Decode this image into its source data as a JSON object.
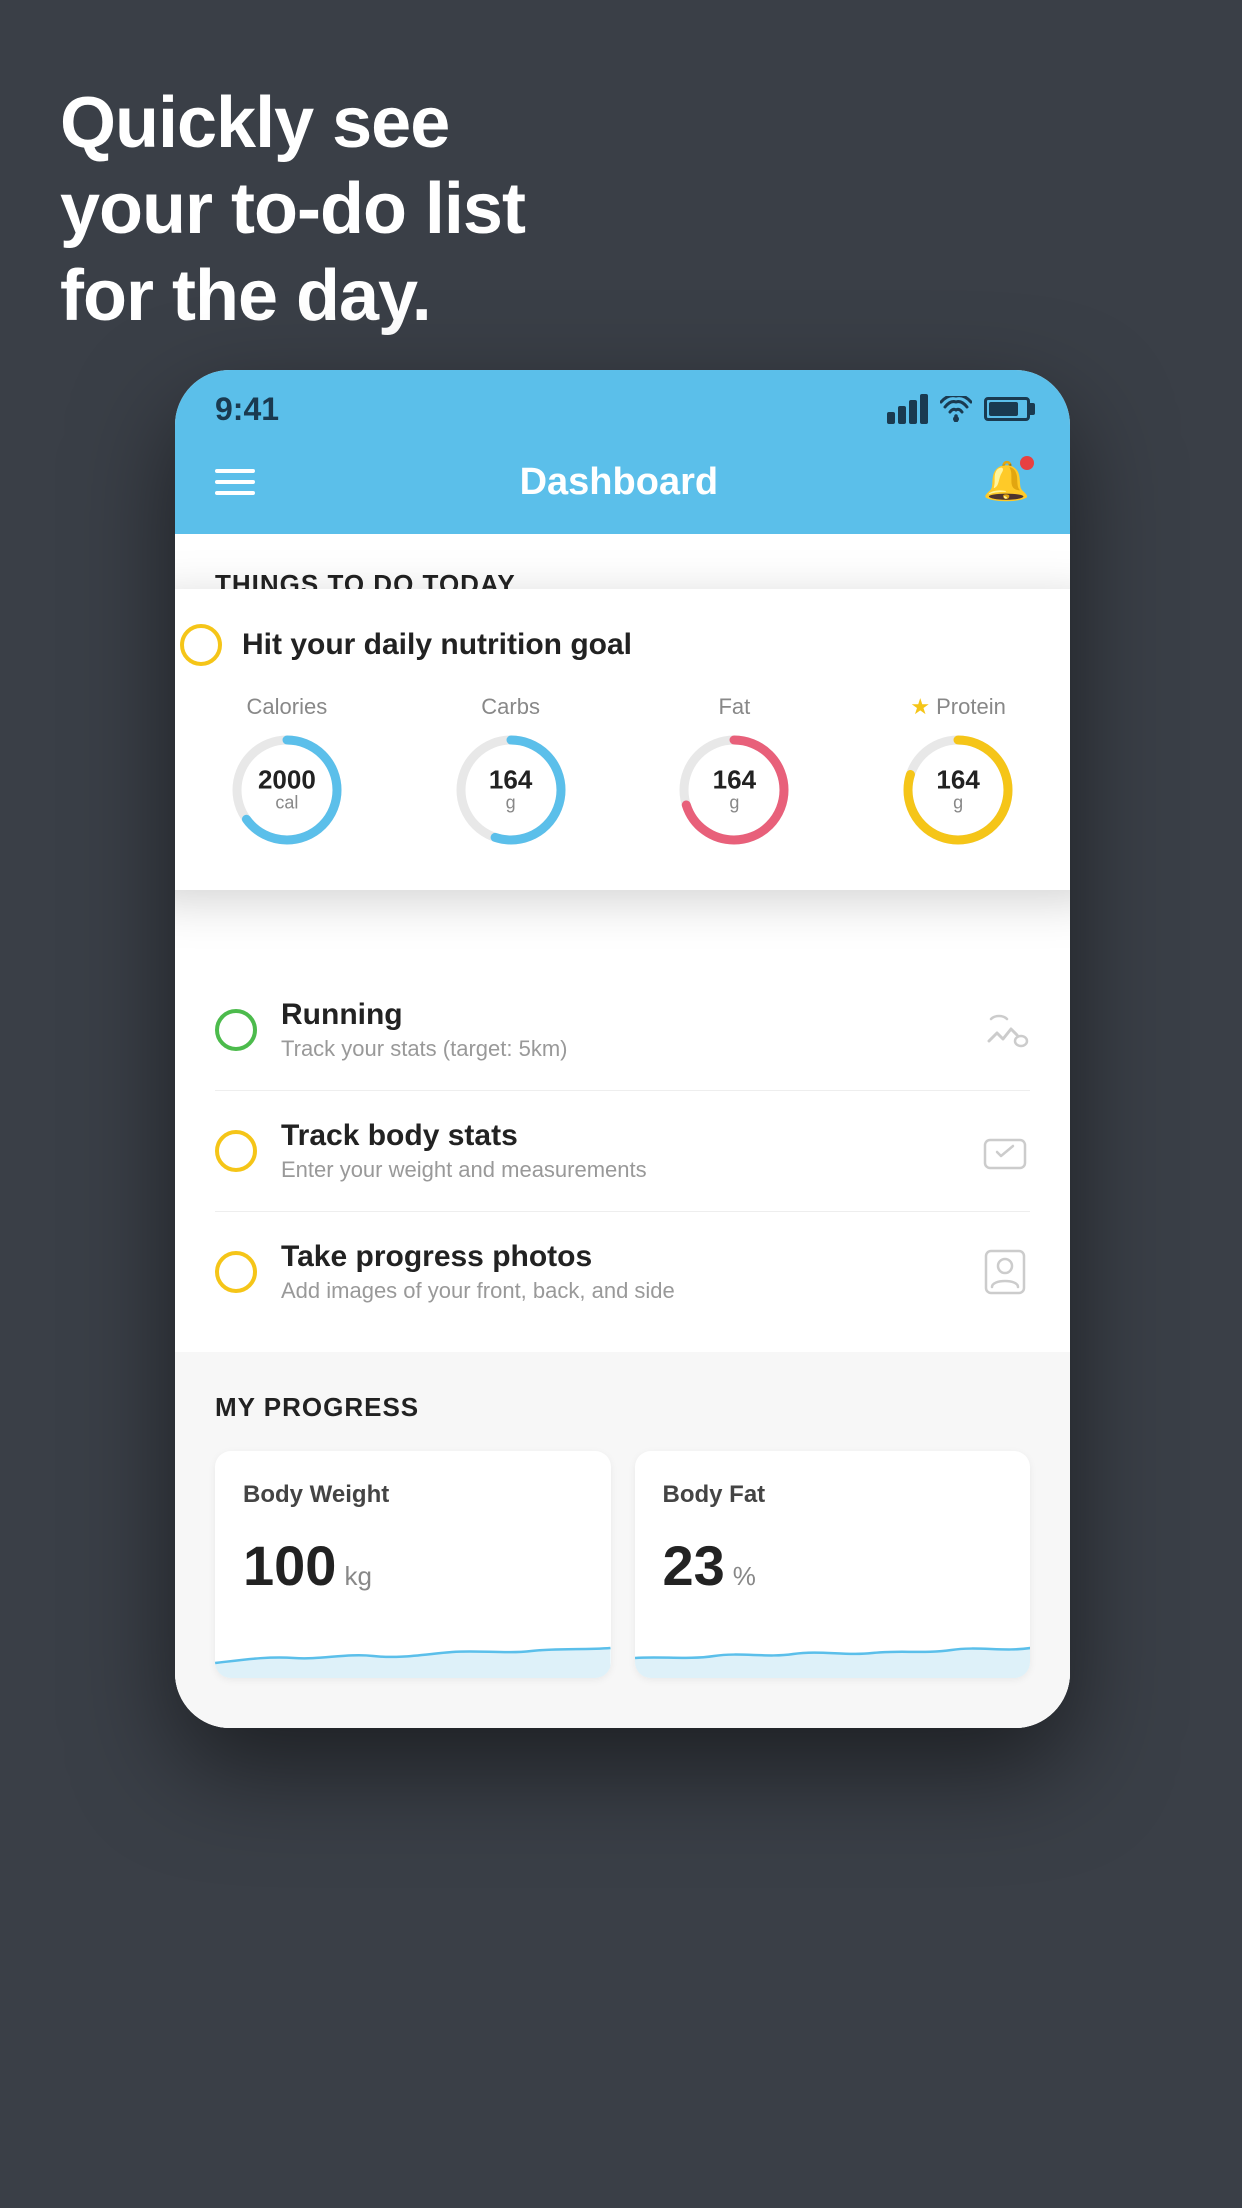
{
  "background_color": "#3a3f47",
  "headline": {
    "line1": "Quickly see",
    "line2": "your to-do list",
    "line3": "for the day."
  },
  "status_bar": {
    "time": "9:41"
  },
  "header": {
    "title": "Dashboard"
  },
  "things_today": {
    "section_title": "THINGS TO DO TODAY",
    "floating_card": {
      "title": "Hit your daily nutrition goal",
      "nutrients": [
        {
          "label": "Calories",
          "value": "2000",
          "unit": "cal",
          "color": "#5bbfea",
          "pct": 65
        },
        {
          "label": "Carbs",
          "value": "164",
          "unit": "g",
          "color": "#5bbfea",
          "pct": 55
        },
        {
          "label": "Fat",
          "value": "164",
          "unit": "g",
          "color": "#e8607a",
          "pct": 70
        },
        {
          "label": "Protein",
          "value": "164",
          "unit": "g",
          "color": "#f5c518",
          "pct": 80,
          "starred": true
        }
      ]
    },
    "list_items": [
      {
        "title": "Running",
        "subtitle": "Track your stats (target: 5km)",
        "icon": "shoe",
        "check_color": "#4cbb4c"
      },
      {
        "title": "Track body stats",
        "subtitle": "Enter your weight and measurements",
        "icon": "scale",
        "check_color": "#f5c518"
      },
      {
        "title": "Take progress photos",
        "subtitle": "Add images of your front, back, and side",
        "icon": "person",
        "check_color": "#f5c518"
      }
    ]
  },
  "progress": {
    "section_title": "MY PROGRESS",
    "cards": [
      {
        "title": "Body Weight",
        "value": "100",
        "unit": "kg"
      },
      {
        "title": "Body Fat",
        "value": "23",
        "unit": "%"
      }
    ]
  }
}
